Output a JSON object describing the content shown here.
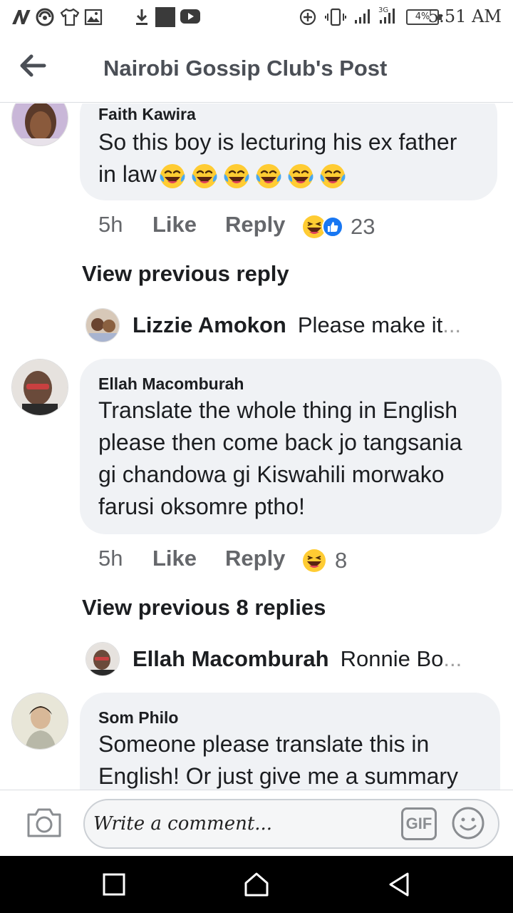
{
  "status_bar": {
    "time": "5:51 AM",
    "battery": "4%",
    "network": "3G",
    "left_icons": [
      "n-icon",
      "signal-swirl-icon",
      "tshirt-icon",
      "image-icon"
    ],
    "mid_icons": [
      "download-icon",
      "square-icon",
      "youtube-icon"
    ],
    "right_icons": [
      "plus-circle-icon",
      "vibrate-icon",
      "signal-icon",
      "signal-3g-icon"
    ]
  },
  "header": {
    "title": "Nairobi Gossip Club's Post"
  },
  "comments": [
    {
      "author": "Faith Kawira",
      "lines": [
        "So this boy is lecturing his ex father",
        "in law"
      ],
      "emoji_count": 6,
      "time": "5h",
      "like": "Like",
      "reply": "Reply",
      "reactions": "23",
      "view_replies": "View previous reply",
      "last_reply": {
        "name": "Lizzie Amokon",
        "text": "Please make it",
        "ellipsis": "..."
      }
    },
    {
      "author": "Ellah Macomburah",
      "lines": [
        "Translate the whole thing in English",
        "please then come back jo tangsania",
        "gi chandowa gi Kiswahili morwako",
        "farusi oksomre ptho!"
      ],
      "time": "5h",
      "like": "Like",
      "reply": "Reply",
      "reactions": "8",
      "view_replies": "View previous 8 replies",
      "last_reply": {
        "name": "Ellah Macomburah",
        "text": "Ronnie Bo",
        "ellipsis": "..."
      }
    },
    {
      "author": "Som Philo",
      "lines": [
        "Someone please translate this in",
        "English! Or just give me a summary"
      ]
    }
  ],
  "composer": {
    "placeholder": "Write a comment...",
    "gif_label": "GIF"
  },
  "colors": {
    "bubble": "#f0f2f5",
    "like_blue": "#1877f2",
    "emoji_yellow": "#ffcc33",
    "text_gray": "#65676b"
  }
}
